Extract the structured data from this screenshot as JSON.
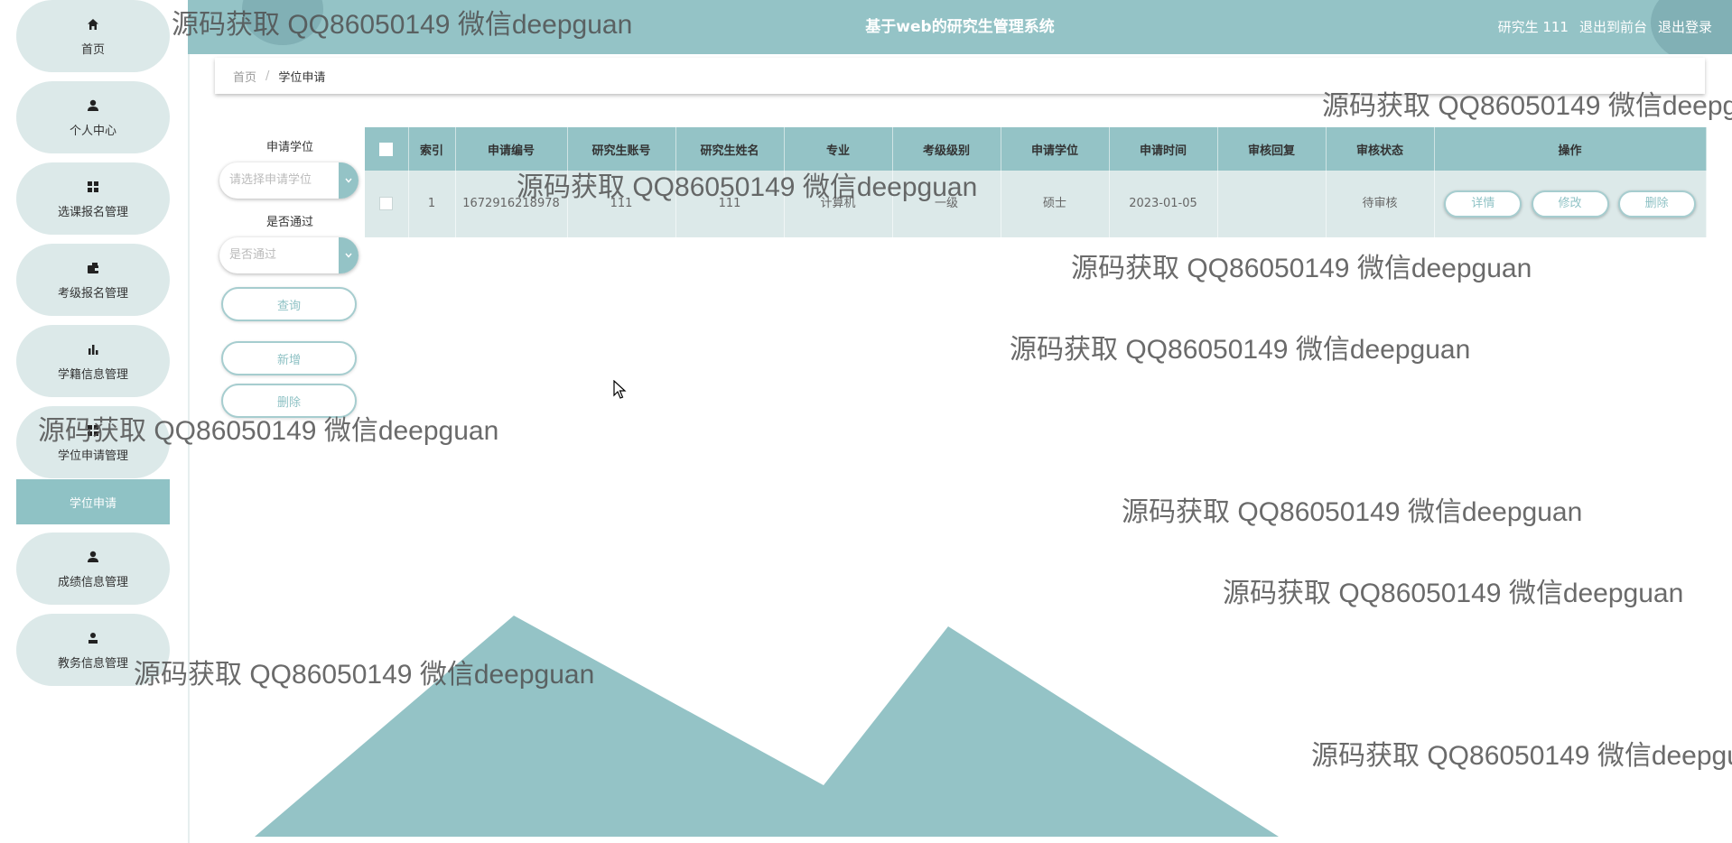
{
  "header": {
    "title": "基于web的研究生管理系统",
    "user": "研究生 111",
    "to_front": "退出到前台",
    "logout": "退出登录"
  },
  "sidebar": {
    "items": [
      {
        "label": "首页",
        "icon": "home-icon"
      },
      {
        "label": "个人中心",
        "icon": "user-icon"
      },
      {
        "label": "选课报名管理",
        "icon": "grid-icon"
      },
      {
        "label": "考级报名管理",
        "icon": "wallet-icon"
      },
      {
        "label": "学籍信息管理",
        "icon": "bar-chart-icon"
      },
      {
        "label": "学位申请管理",
        "icon": "grid-icon"
      },
      {
        "label": "成绩信息管理",
        "icon": "user-icon"
      },
      {
        "label": "教务信息管理",
        "icon": "user-icon"
      }
    ],
    "sub_active": "学位申请"
  },
  "breadcrumb": {
    "home": "首页",
    "sep": "/",
    "current": "学位申请"
  },
  "search": {
    "degree_label": "申请学位",
    "degree_placeholder": "请选择申请学位",
    "pass_label": "是否通过",
    "pass_placeholder": "是否通过",
    "query": "查询",
    "add": "新增",
    "delete": "删除"
  },
  "table": {
    "columns": [
      "索引",
      "申请编号",
      "研究生账号",
      "研究生姓名",
      "专业",
      "考级级别",
      "申请学位",
      "申请时间",
      "审核回复",
      "审核状态",
      "操作"
    ],
    "rows": [
      {
        "index": "1",
        "app_no": "1672916218978",
        "account": "111",
        "name": "111",
        "major": "计算机",
        "level": "一级",
        "degree": "硕士",
        "time": "2023-01-05",
        "reply": "",
        "status": "待审核"
      }
    ],
    "actions": {
      "detail": "详情",
      "edit": "修改",
      "delete": "删除"
    }
  },
  "watermark": "源码获取 QQ86050149 微信deepguan",
  "colors": {
    "theme": "#94c3c6",
    "light": "#dce9e9"
  }
}
